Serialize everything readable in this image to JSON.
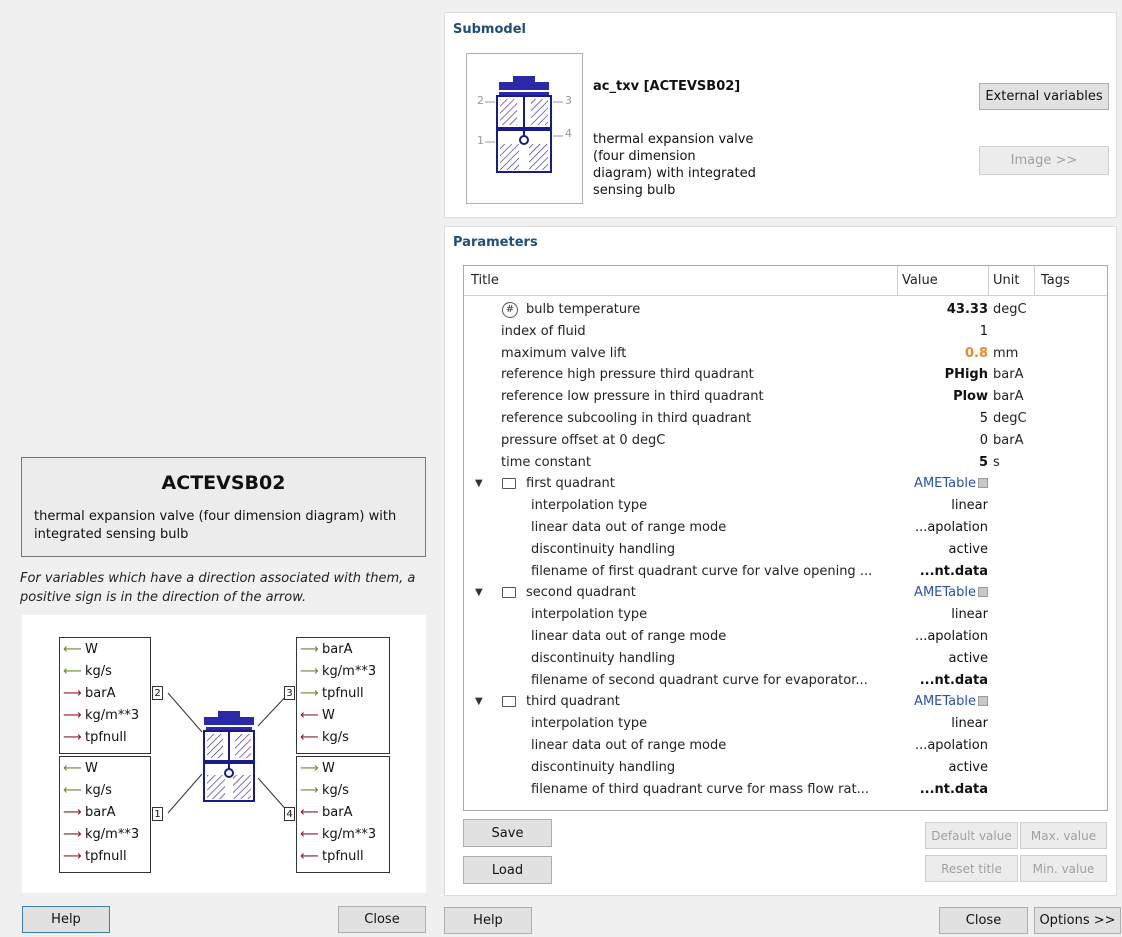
{
  "left": {
    "model_name": "ACTEVSB02",
    "model_desc": "thermal expansion valve (four dimension diagram) with integrated sensing bulb",
    "sign_note": "For variables which have a direction associated with them, a positive sign is in the direction of the arrow.",
    "help_label": "Help",
    "close_label": "Close",
    "ports": {
      "top_left": {
        "number": "2",
        "items": [
          {
            "dir": "in",
            "label": "W"
          },
          {
            "dir": "in",
            "label": "kg/s"
          },
          {
            "dir": "out",
            "label": "barA"
          },
          {
            "dir": "out",
            "label": "kg/m**3"
          },
          {
            "dir": "out",
            "label": "tpfnull"
          }
        ]
      },
      "bottom_left": {
        "number": "1",
        "items": [
          {
            "dir": "in",
            "label": "W"
          },
          {
            "dir": "in",
            "label": "kg/s"
          },
          {
            "dir": "out",
            "label": "barA"
          },
          {
            "dir": "out",
            "label": "kg/m**3"
          },
          {
            "dir": "out",
            "label": "tpfnull"
          }
        ]
      },
      "top_right": {
        "number": "3",
        "items": [
          {
            "dir": "in",
            "label": "barA"
          },
          {
            "dir": "in",
            "label": "kg/m**3"
          },
          {
            "dir": "in",
            "label": "tpfnull"
          },
          {
            "dir": "out",
            "label": "W"
          },
          {
            "dir": "out",
            "label": "kg/s"
          }
        ]
      },
      "bottom_right": {
        "number": "4",
        "items": [
          {
            "dir": "in",
            "label": "W"
          },
          {
            "dir": "in",
            "label": "kg/s"
          },
          {
            "dir": "out",
            "label": "barA"
          },
          {
            "dir": "out",
            "label": "kg/m**3"
          },
          {
            "dir": "out",
            "label": "tpfnull"
          }
        ]
      }
    }
  },
  "submodel": {
    "section_title": "Submodel",
    "name": "ac_txv [ACTEVSB02]",
    "desc_lines": [
      "thermal expansion valve",
      "(four dimension",
      "diagram) with integrated",
      "sensing bulb"
    ],
    "icon_ports": [
      "2",
      "3",
      "1",
      "4"
    ],
    "external_vars_label": "External variables",
    "image_label": "Image >>"
  },
  "parameters": {
    "section_title": "Parameters",
    "headers": {
      "title": "Title",
      "value": "Value",
      "unit": "Unit",
      "tags": "Tags"
    },
    "rows": [
      {
        "title": "bulb temperature",
        "value": "43.33",
        "unit": "degC",
        "style": "bold",
        "icon": "hash"
      },
      {
        "title": "index of fluid",
        "value": "1",
        "unit": ""
      },
      {
        "title": "maximum valve lift",
        "value": "0.8",
        "unit": "mm",
        "style": "orange"
      },
      {
        "title": "reference high pressure third quadrant",
        "value": "PHigh",
        "unit": "barA",
        "style": "bold"
      },
      {
        "title": "reference low pressure in third quadrant",
        "value": "Plow",
        "unit": "barA",
        "style": "bold"
      },
      {
        "title": "reference subcooling in third quadrant",
        "value": "5",
        "unit": "degC"
      },
      {
        "title": "pressure offset at 0 degC",
        "value": "0",
        "unit": "barA"
      },
      {
        "title": "time constant",
        "value": "5",
        "unit": "s",
        "style": "bold"
      },
      {
        "title": "first quadrant",
        "value": "AMETable",
        "unit": "",
        "style": "link",
        "group": true
      },
      {
        "title": "interpolation type",
        "value": "linear",
        "unit": "",
        "child": true
      },
      {
        "title": "linear data out of range mode",
        "value": "...apolation",
        "unit": "",
        "child": true
      },
      {
        "title": "discontinuity handling",
        "value": "active",
        "unit": "",
        "child": true
      },
      {
        "title": "filename of first quadrant curve for valve opening ...",
        "value": "...nt.data",
        "unit": "",
        "style": "bold",
        "child": true
      },
      {
        "title": "second quadrant",
        "value": "AMETable",
        "unit": "",
        "style": "link",
        "group": true
      },
      {
        "title": "interpolation type",
        "value": "linear",
        "unit": "",
        "child": true
      },
      {
        "title": "linear data out of range mode",
        "value": "...apolation",
        "unit": "",
        "child": true
      },
      {
        "title": "discontinuity handling",
        "value": "active",
        "unit": "",
        "child": true
      },
      {
        "title": "filename of second quadrant curve for evaporator...",
        "value": "...nt.data",
        "unit": "",
        "style": "bold",
        "child": true
      },
      {
        "title": "third quadrant",
        "value": "AMETable",
        "unit": "",
        "style": "link",
        "group": true
      },
      {
        "title": "interpolation type",
        "value": "linear",
        "unit": "",
        "child": true
      },
      {
        "title": "linear data out of range mode",
        "value": "...apolation",
        "unit": "",
        "child": true
      },
      {
        "title": "discontinuity handling",
        "value": "active",
        "unit": "",
        "child": true
      },
      {
        "title": "filename of third quadrant curve for mass flow rat...",
        "value": "...nt.data",
        "unit": "",
        "style": "bold",
        "child": true
      }
    ],
    "save_label": "Save",
    "load_label": "Load",
    "default_value_label": "Default value",
    "max_value_label": "Max. value",
    "reset_title_label": "Reset title",
    "min_value_label": "Min. value"
  },
  "footer": {
    "help_label": "Help",
    "close_label": "Close",
    "options_label": "Options >>"
  }
}
